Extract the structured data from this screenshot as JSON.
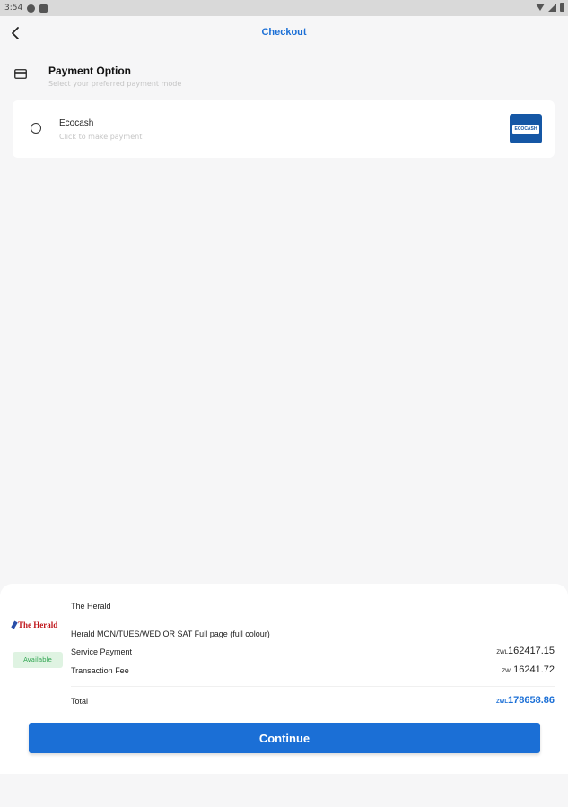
{
  "status_bar": {
    "time": "3:54"
  },
  "header": {
    "title": "Checkout"
  },
  "payment_section": {
    "title": "Payment Option",
    "subtitle": "Select your preferred payment mode"
  },
  "payment_options": [
    {
      "name": "Ecocash",
      "hint": "Click to make payment",
      "logo_text": "ECOCASH",
      "brand_color": "#1557a5",
      "selected": false
    }
  ],
  "order": {
    "publisher": "The Herald",
    "logo_text": "The Herald",
    "availability": "Available",
    "item": "Herald MON/TUES/WED OR SAT Full page (full colour)",
    "currency": "ZWL",
    "rows": [
      {
        "label": "Service Payment",
        "amount": "162417.15"
      },
      {
        "label": "Transaction Fee",
        "amount": "16241.72"
      }
    ],
    "total_label": "Total",
    "total_amount": "178658.86"
  },
  "actions": {
    "continue_label": "Continue"
  },
  "colors": {
    "accent": "#1b6fd6",
    "available_bg": "#dff3e2",
    "available_text": "#2ea44f",
    "herald_red": "#c0161b"
  }
}
